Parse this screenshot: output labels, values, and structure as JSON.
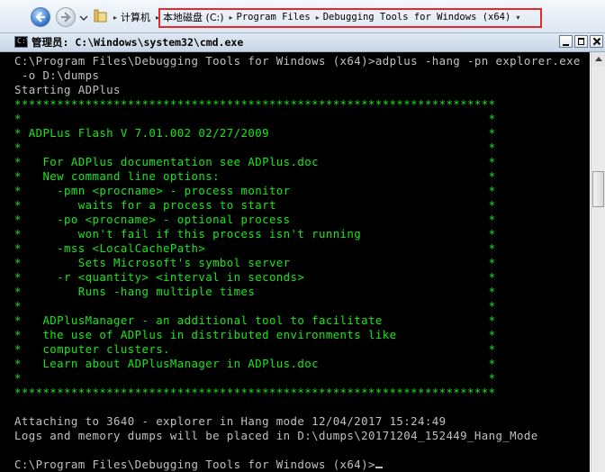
{
  "address_bar": {
    "breadcrumbs": [
      "计算机",
      "本地磁盘 (C:)",
      "Program Files",
      "Debugging Tools for Windows (x64)"
    ]
  },
  "cmd_window": {
    "title": "管理员: C:\\Windows\\system32\\cmd.exe",
    "command_lines": [
      "C:\\Program Files\\Debugging Tools for Windows (x64)>adplus -hang -pn explorer.exe",
      " -o D:\\dumps",
      "Starting ADPlus"
    ],
    "banner_lines": [
      "********************************************************************",
      "*                                                                  *",
      "* ADPLus Flash V 7.01.002 02/27/2009                               *",
      "*                                                                  *",
      "*   For ADPlus documentation see ADPlus.doc                        *",
      "*   New command line options:                                      *",
      "*     -pmn <procname> - process monitor                            *",
      "*        waits for a process to start                              *",
      "*     -po <procname> - optional process                            *",
      "*        won't fail if this process isn't running                  *",
      "*     -mss <LocalCachePath>                                        *",
      "*        Sets Microsoft's symbol server                            *",
      "*     -r <quantity> <interval in seconds>                          *",
      "*        Runs -hang multiple times                                 *",
      "*                                                                  *",
      "*   ADPlusManager - an additional tool to facilitate               *",
      "*   the use of ADPlus in distributed environments like             *",
      "*   computer clusters.                                             *",
      "*   Learn about ADPlusManager in ADPlus.doc                        *",
      "*                                                                  *",
      "********************************************************************"
    ],
    "status_lines": [
      "",
      "Attaching to 3640 - explorer in Hang mode 12/04/2017 15:24:49",
      "Logs and memory dumps will be placed in D:\\dumps\\20171204_152449_Hang_Mode",
      ""
    ],
    "prompt": "C:\\Program Files\\Debugging Tools for Windows (x64)>"
  },
  "colors": {
    "banner": "#19e619",
    "text": "#c0c0c0",
    "highlight_box": "#e8282e"
  }
}
